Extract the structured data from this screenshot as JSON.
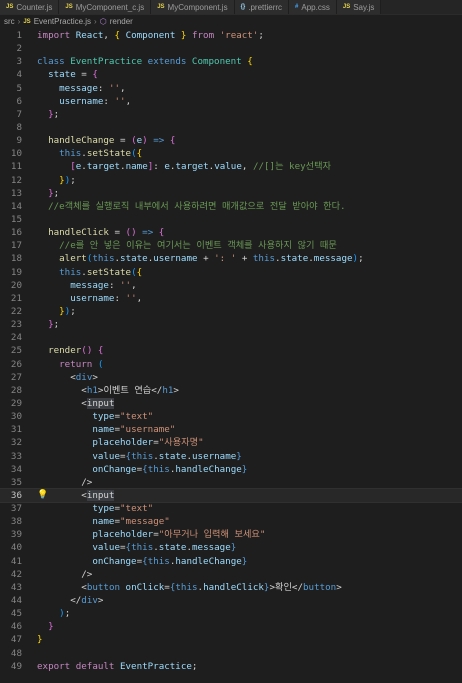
{
  "tabs": [
    {
      "icon": "JS",
      "label": "Counter.js",
      "active": false
    },
    {
      "icon": "JS",
      "label": "MyComponent_c.js",
      "active": false
    },
    {
      "icon": "JS",
      "label": "MyComponent.js",
      "active": false
    },
    {
      "icon": "{}",
      "label": ".prettierrc",
      "active": false
    },
    {
      "icon": "#",
      "label": "App.css",
      "active": false
    },
    {
      "icon": "JS",
      "label": "Say.js",
      "active": false
    }
  ],
  "breadcrumb": {
    "folder": "src",
    "file_icon": "JS",
    "file": "EventPractice.js",
    "symbol": "render"
  },
  "editor": {
    "current_line": 36,
    "lines": [
      [
        [
          "kw",
          "import "
        ],
        [
          "var",
          "React"
        ],
        [
          "pn",
          ", "
        ],
        [
          "br1",
          "{ "
        ],
        [
          "var",
          "Component"
        ],
        [
          "br1",
          " }"
        ],
        [
          "kw",
          " from "
        ],
        [
          "str",
          "'react'"
        ],
        [
          "pn",
          ";"
        ]
      ],
      [],
      [
        [
          "kb",
          "class "
        ],
        [
          "cls",
          "EventPractice "
        ],
        [
          "kb",
          "extends "
        ],
        [
          "cls",
          "Component "
        ],
        [
          "br1",
          "{"
        ]
      ],
      [
        [
          "pn",
          "  "
        ],
        [
          "var",
          "state"
        ],
        [
          "pn",
          " = "
        ],
        [
          "br2",
          "{"
        ]
      ],
      [
        [
          "pn",
          "    "
        ],
        [
          "var",
          "message"
        ],
        [
          "pn",
          ": "
        ],
        [
          "str",
          "''"
        ],
        [
          "pn",
          ","
        ]
      ],
      [
        [
          "pn",
          "    "
        ],
        [
          "var",
          "username"
        ],
        [
          "pn",
          ": "
        ],
        [
          "str",
          "''"
        ],
        [
          "pn",
          ","
        ]
      ],
      [
        [
          "pn",
          "  "
        ],
        [
          "br2",
          "}"
        ],
        [
          "pn",
          ";"
        ]
      ],
      [],
      [
        [
          "pn",
          "  "
        ],
        [
          "fn",
          "handleChange"
        ],
        [
          "pn",
          " = "
        ],
        [
          "br2",
          "("
        ],
        [
          "var",
          "e"
        ],
        [
          "br2",
          ")"
        ],
        [
          "kb",
          " => "
        ],
        [
          "br2",
          "{"
        ]
      ],
      [
        [
          "pn",
          "    "
        ],
        [
          "kb",
          "this"
        ],
        [
          "pn",
          "."
        ],
        [
          "fn",
          "setState"
        ],
        [
          "br3",
          "("
        ],
        [
          "br1",
          "{"
        ]
      ],
      [
        [
          "pn",
          "      "
        ],
        [
          "br2",
          "["
        ],
        [
          "var",
          "e"
        ],
        [
          "pn",
          "."
        ],
        [
          "var",
          "target"
        ],
        [
          "pn",
          "."
        ],
        [
          "var",
          "name"
        ],
        [
          "br2",
          "]"
        ],
        [
          "pn",
          ": "
        ],
        [
          "var",
          "e"
        ],
        [
          "pn",
          "."
        ],
        [
          "var",
          "target"
        ],
        [
          "pn",
          "."
        ],
        [
          "var",
          "value"
        ],
        [
          "pn",
          ", "
        ],
        [
          "cm",
          "//[]는 key선택자"
        ]
      ],
      [
        [
          "pn",
          "    "
        ],
        [
          "br1",
          "}"
        ],
        [
          "br3",
          ")"
        ],
        [
          "pn",
          ";"
        ]
      ],
      [
        [
          "pn",
          "  "
        ],
        [
          "br2",
          "}"
        ],
        [
          "pn",
          ";"
        ]
      ],
      [
        [
          "pn",
          "  "
        ],
        [
          "cm",
          "//e객체를 실행로직 내부에서 사용하려면 매개값으로 전달 받아야 한다."
        ]
      ],
      [],
      [
        [
          "pn",
          "  "
        ],
        [
          "fn",
          "handleClick"
        ],
        [
          "pn",
          " = "
        ],
        [
          "br2",
          "()"
        ],
        [
          "kb",
          " => "
        ],
        [
          "br2",
          "{"
        ]
      ],
      [
        [
          "pn",
          "    "
        ],
        [
          "cm",
          "//e를 안 넣은 이유는 여기서는 이벤트 객체를 사용하지 않기 때문"
        ]
      ],
      [
        [
          "pn",
          "    "
        ],
        [
          "fn",
          "alert"
        ],
        [
          "br3",
          "("
        ],
        [
          "kb",
          "this"
        ],
        [
          "pn",
          "."
        ],
        [
          "var",
          "state"
        ],
        [
          "pn",
          "."
        ],
        [
          "var",
          "username"
        ],
        [
          "pn",
          " + "
        ],
        [
          "str",
          "': '"
        ],
        [
          "pn",
          " + "
        ],
        [
          "kb",
          "this"
        ],
        [
          "pn",
          "."
        ],
        [
          "var",
          "state"
        ],
        [
          "pn",
          "."
        ],
        [
          "var",
          "message"
        ],
        [
          "br3",
          ")"
        ],
        [
          "pn",
          ";"
        ]
      ],
      [
        [
          "pn",
          "    "
        ],
        [
          "kb",
          "this"
        ],
        [
          "pn",
          "."
        ],
        [
          "fn",
          "setState"
        ],
        [
          "br3",
          "("
        ],
        [
          "br1",
          "{"
        ]
      ],
      [
        [
          "pn",
          "      "
        ],
        [
          "var",
          "message"
        ],
        [
          "pn",
          ": "
        ],
        [
          "str",
          "''"
        ],
        [
          "pn",
          ","
        ]
      ],
      [
        [
          "pn",
          "      "
        ],
        [
          "var",
          "username"
        ],
        [
          "pn",
          ": "
        ],
        [
          "str",
          "''"
        ],
        [
          "pn",
          ","
        ]
      ],
      [
        [
          "pn",
          "    "
        ],
        [
          "br1",
          "}"
        ],
        [
          "br3",
          ")"
        ],
        [
          "pn",
          ";"
        ]
      ],
      [
        [
          "pn",
          "  "
        ],
        [
          "br2",
          "}"
        ],
        [
          "pn",
          ";"
        ]
      ],
      [],
      [
        [
          "pn",
          "  "
        ],
        [
          "fn",
          "render"
        ],
        [
          "br2",
          "()"
        ],
        [
          "pn",
          " "
        ],
        [
          "br2",
          "{"
        ]
      ],
      [
        [
          "pn",
          "    "
        ],
        [
          "kw",
          "return"
        ],
        [
          "pn",
          " "
        ],
        [
          "br3",
          "("
        ]
      ],
      [
        [
          "pn",
          "      "
        ],
        [
          "pn",
          "<"
        ],
        [
          "tg",
          "div"
        ],
        [
          "pn",
          ">"
        ]
      ],
      [
        [
          "pn",
          "        "
        ],
        [
          "pn",
          "<"
        ],
        [
          "tg",
          "h1"
        ],
        [
          "pn",
          ">"
        ],
        [
          "pn",
          "이벤트 연습"
        ],
        [
          "pn",
          "</"
        ],
        [
          "tg",
          "h1"
        ],
        [
          "pn",
          ">"
        ]
      ],
      [
        [
          "pn",
          "        "
        ],
        [
          "pn",
          "<"
        ],
        [
          "hl",
          "input"
        ]
      ],
      [
        [
          "pn",
          "          "
        ],
        [
          "attr",
          "type"
        ],
        [
          "pn",
          "="
        ],
        [
          "str",
          "\"text\""
        ]
      ],
      [
        [
          "pn",
          "          "
        ],
        [
          "attr",
          "name"
        ],
        [
          "pn",
          "="
        ],
        [
          "str",
          "\"username\""
        ]
      ],
      [
        [
          "pn",
          "          "
        ],
        [
          "attr",
          "placeholder"
        ],
        [
          "pn",
          "="
        ],
        [
          "str",
          "\"사용자명\""
        ]
      ],
      [
        [
          "pn",
          "          "
        ],
        [
          "attr",
          "value"
        ],
        [
          "pn",
          "="
        ],
        [
          "kb",
          "{"
        ],
        [
          "kb",
          "this"
        ],
        [
          "pn",
          "."
        ],
        [
          "var",
          "state"
        ],
        [
          "pn",
          "."
        ],
        [
          "var",
          "username"
        ],
        [
          "kb",
          "}"
        ]
      ],
      [
        [
          "pn",
          "          "
        ],
        [
          "attr",
          "onChange"
        ],
        [
          "pn",
          "="
        ],
        [
          "kb",
          "{"
        ],
        [
          "kb",
          "this"
        ],
        [
          "pn",
          "."
        ],
        [
          "var",
          "handleChange"
        ],
        [
          "kb",
          "}"
        ]
      ],
      [
        [
          "pn",
          "        "
        ],
        [
          "pn",
          "/>"
        ]
      ],
      [
        [
          "pn",
          "        "
        ],
        [
          "pn",
          "<"
        ],
        [
          "hl",
          "input"
        ]
      ],
      [
        [
          "pn",
          "          "
        ],
        [
          "attr",
          "type"
        ],
        [
          "pn",
          "="
        ],
        [
          "str",
          "\"text\""
        ]
      ],
      [
        [
          "pn",
          "          "
        ],
        [
          "attr",
          "name"
        ],
        [
          "pn",
          "="
        ],
        [
          "str",
          "\"message\""
        ]
      ],
      [
        [
          "pn",
          "          "
        ],
        [
          "attr",
          "placeholder"
        ],
        [
          "pn",
          "="
        ],
        [
          "str",
          "\"아무거나 입력해 보세요\""
        ]
      ],
      [
        [
          "pn",
          "          "
        ],
        [
          "attr",
          "value"
        ],
        [
          "pn",
          "="
        ],
        [
          "kb",
          "{"
        ],
        [
          "kb",
          "this"
        ],
        [
          "pn",
          "."
        ],
        [
          "var",
          "state"
        ],
        [
          "pn",
          "."
        ],
        [
          "var",
          "message"
        ],
        [
          "kb",
          "}"
        ]
      ],
      [
        [
          "pn",
          "          "
        ],
        [
          "attr",
          "onChange"
        ],
        [
          "pn",
          "="
        ],
        [
          "kb",
          "{"
        ],
        [
          "kb",
          "this"
        ],
        [
          "pn",
          "."
        ],
        [
          "var",
          "handleChange"
        ],
        [
          "kb",
          "}"
        ]
      ],
      [
        [
          "pn",
          "        "
        ],
        [
          "pn",
          "/>"
        ]
      ],
      [
        [
          "pn",
          "        "
        ],
        [
          "pn",
          "<"
        ],
        [
          "tg",
          "button "
        ],
        [
          "attr",
          "onClick"
        ],
        [
          "pn",
          "="
        ],
        [
          "kb",
          "{"
        ],
        [
          "kb",
          "this"
        ],
        [
          "pn",
          "."
        ],
        [
          "var",
          "handleClick"
        ],
        [
          "kb",
          "}"
        ],
        [
          "pn",
          ">"
        ],
        [
          "pn",
          "확인"
        ],
        [
          "pn",
          "</"
        ],
        [
          "tg",
          "button"
        ],
        [
          "pn",
          ">"
        ]
      ],
      [
        [
          "pn",
          "      "
        ],
        [
          "pn",
          "</"
        ],
        [
          "tg",
          "div"
        ],
        [
          "pn",
          ">"
        ]
      ],
      [
        [
          "pn",
          "    "
        ],
        [
          "br3",
          ")"
        ],
        [
          "pn",
          ";"
        ]
      ],
      [
        [
          "pn",
          "  "
        ],
        [
          "br2",
          "}"
        ]
      ],
      [
        [
          "br1",
          "}"
        ]
      ],
      [],
      [
        [
          "kw",
          "export default "
        ],
        [
          "var",
          "EventPractice"
        ],
        [
          "pn",
          ";"
        ]
      ]
    ]
  }
}
